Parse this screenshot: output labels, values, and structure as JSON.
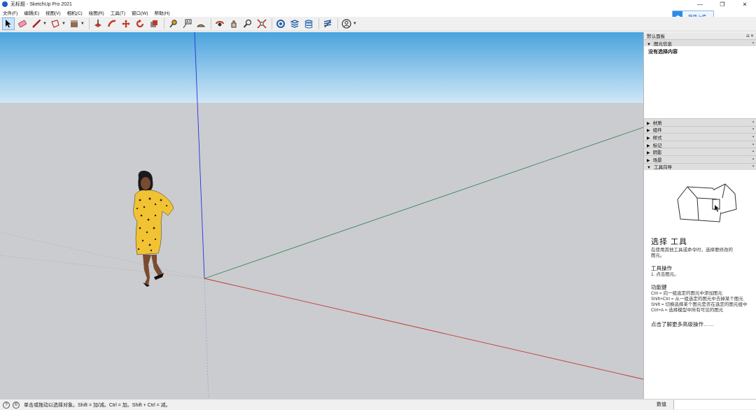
{
  "window": {
    "title": "无标题 - SketchUp Pro 2021",
    "controls": [
      "—",
      "❐",
      "✕"
    ]
  },
  "menu": [
    "文件(F)",
    "编辑(E)",
    "视图(V)",
    "相机(C)",
    "绘图(R)",
    "工具(T)",
    "窗口(W)",
    "帮助(H)"
  ],
  "cloud": {
    "label": "拖拽上传",
    "icon": "cloud-icon"
  },
  "toolbar": {
    "tools": [
      "select-icon",
      "eraser-icon",
      "line-icon",
      "shape-icon",
      "paint-bucket-icon",
      "push-pull-icon",
      "follow-me-icon",
      "move-icon",
      "rotate-icon",
      "scale-icon",
      "tape-measure-icon",
      "text-icon",
      "protractor-icon",
      "orbit-icon",
      "pan-icon",
      "zoom-icon",
      "zoom-extents-icon",
      "warehouse-icon",
      "extension-icon",
      "layers-icon",
      "sandbox-icon",
      "account-icon"
    ]
  },
  "tray": {
    "title": "默认面板",
    "entity_info": {
      "label": "图元信息",
      "content": "没有选择内容"
    },
    "collapsed_panels": [
      "材质",
      "组件",
      "样式",
      "标记",
      "阴影",
      "场景"
    ],
    "instructor": {
      "label": "工具向导",
      "tool_title": "选择 工具",
      "description": "在使用其他工具或命令时，选择要修改的图元。",
      "operation_heading": "工具操作",
      "operation_steps": [
        "1. 点击图元。"
      ],
      "modifier_heading": "功能键",
      "modifier_lines": [
        "Ctrl = 向一组选定的图元中添加图元",
        "Shift+Ctrl = 从一组选定的图元中去掉某个图元",
        "Shift = 切换选择某个图元是否在选定的图元组中",
        "Ctrl+A = 选择模型中所有可见的图元"
      ],
      "more_link": "点击了解更多高级操作……"
    }
  },
  "status": {
    "hint": "单击或拖动以选择对象。Shift = 加/减。Ctrl = 加。Shift + Ctrl = 减。",
    "measurements_label": "数值"
  },
  "colors": {
    "sky_top": "#4aa3de",
    "ground": "#cbccd0",
    "axis_red": "#c0392b",
    "axis_green": "#3a8a5a",
    "axis_blue": "#2b2ee0",
    "dress": "#f1c232"
  }
}
